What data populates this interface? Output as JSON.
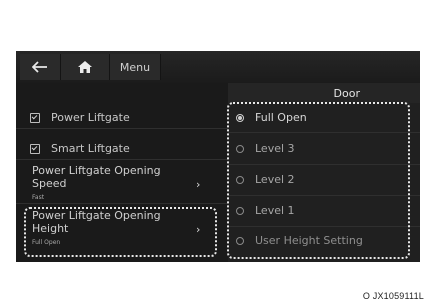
{
  "header": {
    "back_icon": "back-arrow-icon",
    "home_icon": "home-icon",
    "menu_label": "Menu"
  },
  "panel": {
    "title": "Door"
  },
  "left_menu": {
    "power_liftgate": "Power Liftgate",
    "smart_liftgate": "Smart Liftgate",
    "opening_speed_title_1": "Power Liftgate Opening",
    "opening_speed_title_2": "Speed",
    "opening_speed_value": "Fast",
    "opening_height_title_1": "Power Liftgate Opening",
    "opening_height_title_2": "Height",
    "opening_height_value": "Full Open"
  },
  "options": [
    {
      "label": "Full Open",
      "selected": true
    },
    {
      "label": "Level 3",
      "selected": false
    },
    {
      "label": "Level 2",
      "selected": false
    },
    {
      "label": "Level 1",
      "selected": false
    },
    {
      "label": "User Height Setting",
      "selected": false
    }
  ],
  "caption": "O JX1059111L"
}
